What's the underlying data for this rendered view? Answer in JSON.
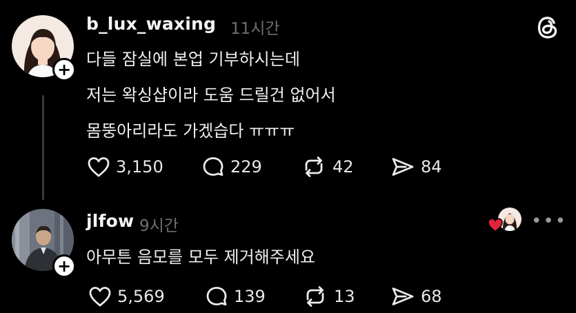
{
  "posts": [
    {
      "username": "b_lux_waxing",
      "time": "11시간",
      "lines": [
        "다들 잠실에 본업 기부하시는데",
        "저는 왁싱샵이라 도움 드릴건 없어서",
        "몸뚱아리라도  가겠습다 ㅠㅠㅠ"
      ],
      "likes": "3,150",
      "comments": "229",
      "reposts": "42",
      "shares": "84"
    },
    {
      "username": "jlfow",
      "time": "9시간",
      "lines": [
        "아무튼 음모를 모두 제거해주세요"
      ],
      "likes": "5,569",
      "comments": "139",
      "reposts": "13",
      "shares": "68"
    }
  ],
  "icons": {
    "like": "heart-icon",
    "comment": "comment-icon",
    "repost": "repost-icon",
    "share": "share-icon",
    "app": "threads-logo-icon",
    "more": "more-icon"
  },
  "colors": {
    "background": "#000000",
    "heart_badge": "#e0243a"
  }
}
